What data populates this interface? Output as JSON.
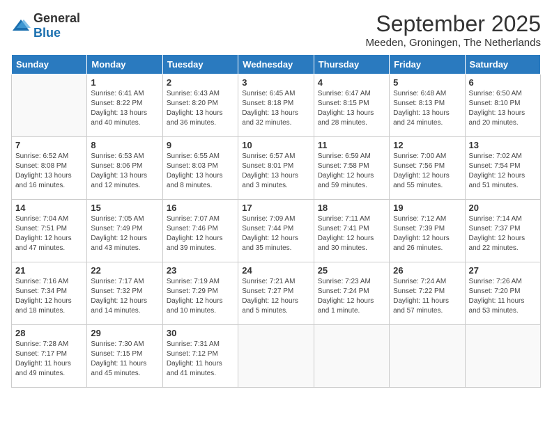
{
  "header": {
    "logo_general": "General",
    "logo_blue": "Blue",
    "month_year": "September 2025",
    "location": "Meeden, Groningen, The Netherlands"
  },
  "calendar": {
    "days_of_week": [
      "Sunday",
      "Monday",
      "Tuesday",
      "Wednesday",
      "Thursday",
      "Friday",
      "Saturday"
    ],
    "weeks": [
      [
        {
          "day": "",
          "info": ""
        },
        {
          "day": "1",
          "info": "Sunrise: 6:41 AM\nSunset: 8:22 PM\nDaylight: 13 hours\nand 40 minutes."
        },
        {
          "day": "2",
          "info": "Sunrise: 6:43 AM\nSunset: 8:20 PM\nDaylight: 13 hours\nand 36 minutes."
        },
        {
          "day": "3",
          "info": "Sunrise: 6:45 AM\nSunset: 8:18 PM\nDaylight: 13 hours\nand 32 minutes."
        },
        {
          "day": "4",
          "info": "Sunrise: 6:47 AM\nSunset: 8:15 PM\nDaylight: 13 hours\nand 28 minutes."
        },
        {
          "day": "5",
          "info": "Sunrise: 6:48 AM\nSunset: 8:13 PM\nDaylight: 13 hours\nand 24 minutes."
        },
        {
          "day": "6",
          "info": "Sunrise: 6:50 AM\nSunset: 8:10 PM\nDaylight: 13 hours\nand 20 minutes."
        }
      ],
      [
        {
          "day": "7",
          "info": "Sunrise: 6:52 AM\nSunset: 8:08 PM\nDaylight: 13 hours\nand 16 minutes."
        },
        {
          "day": "8",
          "info": "Sunrise: 6:53 AM\nSunset: 8:06 PM\nDaylight: 13 hours\nand 12 minutes."
        },
        {
          "day": "9",
          "info": "Sunrise: 6:55 AM\nSunset: 8:03 PM\nDaylight: 13 hours\nand 8 minutes."
        },
        {
          "day": "10",
          "info": "Sunrise: 6:57 AM\nSunset: 8:01 PM\nDaylight: 13 hours\nand 3 minutes."
        },
        {
          "day": "11",
          "info": "Sunrise: 6:59 AM\nSunset: 7:58 PM\nDaylight: 12 hours\nand 59 minutes."
        },
        {
          "day": "12",
          "info": "Sunrise: 7:00 AM\nSunset: 7:56 PM\nDaylight: 12 hours\nand 55 minutes."
        },
        {
          "day": "13",
          "info": "Sunrise: 7:02 AM\nSunset: 7:54 PM\nDaylight: 12 hours\nand 51 minutes."
        }
      ],
      [
        {
          "day": "14",
          "info": "Sunrise: 7:04 AM\nSunset: 7:51 PM\nDaylight: 12 hours\nand 47 minutes."
        },
        {
          "day": "15",
          "info": "Sunrise: 7:05 AM\nSunset: 7:49 PM\nDaylight: 12 hours\nand 43 minutes."
        },
        {
          "day": "16",
          "info": "Sunrise: 7:07 AM\nSunset: 7:46 PM\nDaylight: 12 hours\nand 39 minutes."
        },
        {
          "day": "17",
          "info": "Sunrise: 7:09 AM\nSunset: 7:44 PM\nDaylight: 12 hours\nand 35 minutes."
        },
        {
          "day": "18",
          "info": "Sunrise: 7:11 AM\nSunset: 7:41 PM\nDaylight: 12 hours\nand 30 minutes."
        },
        {
          "day": "19",
          "info": "Sunrise: 7:12 AM\nSunset: 7:39 PM\nDaylight: 12 hours\nand 26 minutes."
        },
        {
          "day": "20",
          "info": "Sunrise: 7:14 AM\nSunset: 7:37 PM\nDaylight: 12 hours\nand 22 minutes."
        }
      ],
      [
        {
          "day": "21",
          "info": "Sunrise: 7:16 AM\nSunset: 7:34 PM\nDaylight: 12 hours\nand 18 minutes."
        },
        {
          "day": "22",
          "info": "Sunrise: 7:17 AM\nSunset: 7:32 PM\nDaylight: 12 hours\nand 14 minutes."
        },
        {
          "day": "23",
          "info": "Sunrise: 7:19 AM\nSunset: 7:29 PM\nDaylight: 12 hours\nand 10 minutes."
        },
        {
          "day": "24",
          "info": "Sunrise: 7:21 AM\nSunset: 7:27 PM\nDaylight: 12 hours\nand 5 minutes."
        },
        {
          "day": "25",
          "info": "Sunrise: 7:23 AM\nSunset: 7:24 PM\nDaylight: 12 hours\nand 1 minute."
        },
        {
          "day": "26",
          "info": "Sunrise: 7:24 AM\nSunset: 7:22 PM\nDaylight: 11 hours\nand 57 minutes."
        },
        {
          "day": "27",
          "info": "Sunrise: 7:26 AM\nSunset: 7:20 PM\nDaylight: 11 hours\nand 53 minutes."
        }
      ],
      [
        {
          "day": "28",
          "info": "Sunrise: 7:28 AM\nSunset: 7:17 PM\nDaylight: 11 hours\nand 49 minutes."
        },
        {
          "day": "29",
          "info": "Sunrise: 7:30 AM\nSunset: 7:15 PM\nDaylight: 11 hours\nand 45 minutes."
        },
        {
          "day": "30",
          "info": "Sunrise: 7:31 AM\nSunset: 7:12 PM\nDaylight: 11 hours\nand 41 minutes."
        },
        {
          "day": "",
          "info": ""
        },
        {
          "day": "",
          "info": ""
        },
        {
          "day": "",
          "info": ""
        },
        {
          "day": "",
          "info": ""
        }
      ]
    ]
  }
}
